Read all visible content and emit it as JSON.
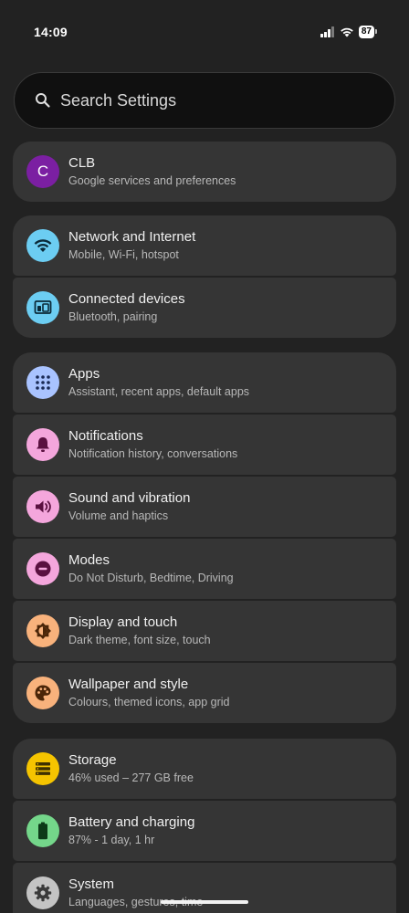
{
  "status_bar": {
    "time": "14:09",
    "battery": "87"
  },
  "search": {
    "placeholder": "Search Settings"
  },
  "account": {
    "avatar_letter": "C",
    "title": "CLB",
    "subtitle": "Google services and preferences",
    "color": "#7b1fa2"
  },
  "groups": {
    "connectivity": [
      {
        "title": "Network and Internet",
        "subtitle": "Mobile, Wi-Fi, hotspot",
        "icon": "wifi-icon",
        "color": "#6ccdf2"
      },
      {
        "title": "Connected devices",
        "subtitle": "Bluetooth, pairing",
        "icon": "connected-devices-icon",
        "color": "#6ccdf2"
      }
    ],
    "apps": [
      {
        "title": "Apps",
        "subtitle": "Assistant, recent apps, default apps",
        "icon": "apps-grid-icon",
        "color": "#a9c3ff"
      },
      {
        "title": "Notifications",
        "subtitle": "Notification history, conversations",
        "icon": "bell-icon",
        "color": "#f4a6dc"
      },
      {
        "title": "Sound and vibration",
        "subtitle": "Volume and haptics",
        "icon": "speaker-icon",
        "color": "#f4a6dc"
      },
      {
        "title": "Modes",
        "subtitle": "Do Not Disturb, Bedtime, Driving",
        "icon": "do-not-disturb-icon",
        "color": "#f4a6dc"
      },
      {
        "title": "Display and touch",
        "subtitle": "Dark theme, font size, touch",
        "icon": "brightness-icon",
        "color": "#f8b27c"
      },
      {
        "title": "Wallpaper and style",
        "subtitle": "Colours, themed icons, app grid",
        "icon": "palette-icon",
        "color": "#f8b27c"
      }
    ],
    "device": [
      {
        "title": "Storage",
        "subtitle": "46% used – 277 GB free",
        "icon": "storage-icon",
        "color": "#f5c400"
      },
      {
        "title": "Battery and charging",
        "subtitle": "87% - 1 day, 1 hr",
        "icon": "battery-icon",
        "color": "#74d68a"
      },
      {
        "title": "System",
        "subtitle": "Languages, gestures, time",
        "icon": "gear-icon",
        "color": "#c4c4c4"
      }
    ]
  }
}
